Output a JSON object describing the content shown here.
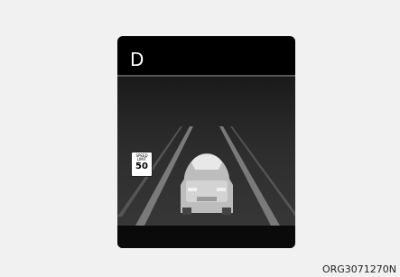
{
  "cluster": {
    "gear": "D",
    "speed_sign": {
      "line1": "SPEED",
      "line2": "LIMIT",
      "value": "50"
    }
  },
  "caption": {
    "code": "ORG3071270N"
  },
  "colors": {
    "background": "#f1f1f1",
    "panel": "#000000",
    "road": "#2a2a2a",
    "lane_line": "#8a8a8a",
    "car_body": "#cfcfcf"
  }
}
